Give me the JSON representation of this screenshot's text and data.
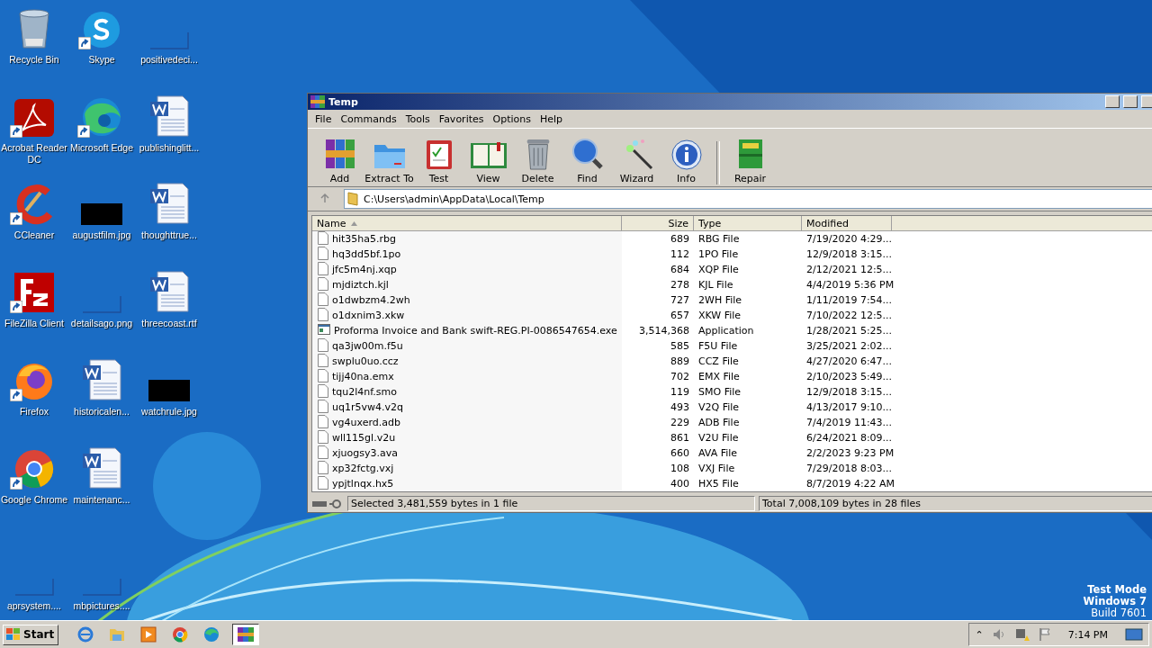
{
  "desktop_icons": [
    {
      "label": "Recycle Bin",
      "kind": "recycle"
    },
    {
      "label": "Skype",
      "kind": "skype"
    },
    {
      "label": "positivedeci...",
      "kind": "blank"
    },
    {
      "label": "Acrobat Reader DC",
      "kind": "acrobat"
    },
    {
      "label": "Microsoft Edge",
      "kind": "edge"
    },
    {
      "label": "publishinglitt...",
      "kind": "word"
    },
    {
      "label": "CCleaner",
      "kind": "ccleaner"
    },
    {
      "label": "augustfilm.jpg",
      "kind": "black"
    },
    {
      "label": "thoughttrue...",
      "kind": "word"
    },
    {
      "label": "FileZilla Client",
      "kind": "filezilla"
    },
    {
      "label": "detailsago.png",
      "kind": "blank"
    },
    {
      "label": "threecoast.rtf",
      "kind": "word"
    },
    {
      "label": "Firefox",
      "kind": "firefox"
    },
    {
      "label": "historicalen...",
      "kind": "word"
    },
    {
      "label": "watchrule.jpg",
      "kind": "black"
    },
    {
      "label": "Google Chrome",
      "kind": "chrome"
    },
    {
      "label": "maintenanc...",
      "kind": "word"
    },
    {
      "label": "aprsystem....",
      "kind": "blank"
    },
    {
      "label": "mbpictures....",
      "kind": "blank"
    }
  ],
  "window": {
    "title": "Temp",
    "menu": [
      "File",
      "Commands",
      "Tools",
      "Favorites",
      "Options",
      "Help"
    ],
    "toolbar": [
      {
        "label": "Add",
        "kind": "add"
      },
      {
        "label": "Extract To",
        "kind": "extract"
      },
      {
        "label": "Test",
        "kind": "test"
      },
      {
        "label": "View",
        "kind": "view"
      },
      {
        "label": "Delete",
        "kind": "delete"
      },
      {
        "label": "Find",
        "kind": "find"
      },
      {
        "label": "Wizard",
        "kind": "wizard"
      },
      {
        "label": "Info",
        "kind": "info"
      },
      {
        "label": "Repair",
        "kind": "repair"
      }
    ],
    "address": "C:\\Users\\admin\\AppData\\Local\\Temp",
    "columns": [
      "Name",
      "Size",
      "Type",
      "Modified"
    ],
    "rows": [
      {
        "name": "hit35ha5.rbg",
        "size": "689",
        "type": "RBG File",
        "modified": "7/19/2020 4:29...",
        "kind": "file"
      },
      {
        "name": "hq3dd5bf.1po",
        "size": "112",
        "type": "1PO File",
        "modified": "12/9/2018 3:15...",
        "kind": "file"
      },
      {
        "name": "jfc5m4nj.xqp",
        "size": "684",
        "type": "XQP File",
        "modified": "2/12/2021 12:5...",
        "kind": "file"
      },
      {
        "name": "mjdiztch.kjl",
        "size": "278",
        "type": "KJL File",
        "modified": "4/4/2019 5:36 PM",
        "kind": "file"
      },
      {
        "name": "o1dwbzm4.2wh",
        "size": "727",
        "type": "2WH File",
        "modified": "1/11/2019 7:54...",
        "kind": "file"
      },
      {
        "name": "o1dxnim3.xkw",
        "size": "657",
        "type": "XKW File",
        "modified": "7/10/2022 12:5...",
        "kind": "file"
      },
      {
        "name": "Proforma Invoice and Bank swift-REG.PI-0086547654.exe",
        "size": "3,514,368",
        "type": "Application",
        "modified": "1/28/2021 5:25...",
        "kind": "exe"
      },
      {
        "name": "qa3jw00m.f5u",
        "size": "585",
        "type": "F5U File",
        "modified": "3/25/2021 2:02...",
        "kind": "file"
      },
      {
        "name": "swplu0uo.ccz",
        "size": "889",
        "type": "CCZ File",
        "modified": "4/27/2020 6:47...",
        "kind": "file"
      },
      {
        "name": "tijj40na.emx",
        "size": "702",
        "type": "EMX File",
        "modified": "2/10/2023 5:49...",
        "kind": "file"
      },
      {
        "name": "tqu2l4nf.smo",
        "size": "119",
        "type": "SMO File",
        "modified": "12/9/2018 3:15...",
        "kind": "file"
      },
      {
        "name": "uq1r5vw4.v2q",
        "size": "493",
        "type": "V2Q File",
        "modified": "4/13/2017 9:10...",
        "kind": "file"
      },
      {
        "name": "vg4uxerd.adb",
        "size": "229",
        "type": "ADB File",
        "modified": "7/4/2019 11:43...",
        "kind": "file"
      },
      {
        "name": "wll115gl.v2u",
        "size": "861",
        "type": "V2U File",
        "modified": "6/24/2021 8:09...",
        "kind": "file"
      },
      {
        "name": "xjuogsy3.ava",
        "size": "660",
        "type": "AVA File",
        "modified": "2/2/2023 9:23 PM",
        "kind": "file"
      },
      {
        "name": "xp32fctg.vxj",
        "size": "108",
        "type": "VXJ File",
        "modified": "7/29/2018 8:03...",
        "kind": "file"
      },
      {
        "name": "ypjtlnqx.hx5",
        "size": "400",
        "type": "HX5 File",
        "modified": "8/7/2019 4:22 AM",
        "kind": "file"
      }
    ],
    "status_selected": "Selected 3,481,559 bytes in 1 file",
    "status_total": "Total 7,008,109 bytes in 28 files"
  },
  "os_info": [
    "Test Mode",
    "Windows 7",
    "Build 7601"
  ],
  "taskbar": {
    "start": "Start",
    "apps": [
      {
        "kind": "ie",
        "selected": false
      },
      {
        "kind": "explorer",
        "selected": false
      },
      {
        "kind": "media",
        "selected": false
      },
      {
        "kind": "chrome",
        "selected": false
      },
      {
        "kind": "edge",
        "selected": false
      },
      {
        "kind": "winrar",
        "selected": true
      }
    ],
    "tray_chevron": "⌃",
    "time": "7:14 PM"
  }
}
